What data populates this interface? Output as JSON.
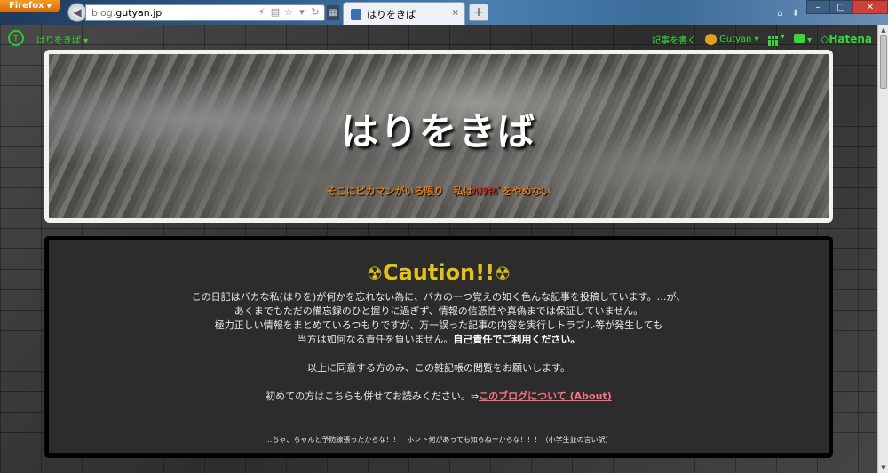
{
  "browser": {
    "menu_button": "Firefox",
    "url_prefix": "blog.",
    "url_host": "gutyan.jp",
    "tab_title": "はりをきば",
    "new_tab": "+",
    "close_tab": "×"
  },
  "hatena_bar": {
    "blog_link": "はりをきば ▾",
    "write_article": "記事を書く",
    "user_name": "Gutyan ▾",
    "hatena": "Hatena"
  },
  "header": {
    "title": "はりをきば",
    "subtitle_part1": "そこにピカマンがいる限り　私は",
    "subtitle_part2": "ﾊﾘｦｷﾊﾞ",
    "subtitle_part3": "をやめない"
  },
  "caution": {
    "title": "Caution!!",
    "line1": "この日記はバカな私(はりを)が何かを忘れない為に、バカの一つ覚えの如く色んな記事を投稿しています。…が、",
    "line2": "あくまでもただの備忘録のひと握りに過ぎず、情報の信憑性や真偽までは保証していません。",
    "line3": "極力正しい情報をまとめているつもりですが、万一誤った記事の内容を実行しトラブル等が発生しても",
    "line4_normal": "当方は如何なる責任を負いません。",
    "line4_bold": "自己責任でご利用ください。",
    "agree": "以上に同意する方のみ、この雑記帳の閲覧をお願いします。",
    "first_time": "初めての方はこちらも併せてお読みください。⇒",
    "about_link": "このブログについて (About)",
    "excuse": "…ちゃ、ちゃんと予防線張ったからな！！　ホント何があっても知らねーからな！！！（小学生並の言い訳）"
  }
}
